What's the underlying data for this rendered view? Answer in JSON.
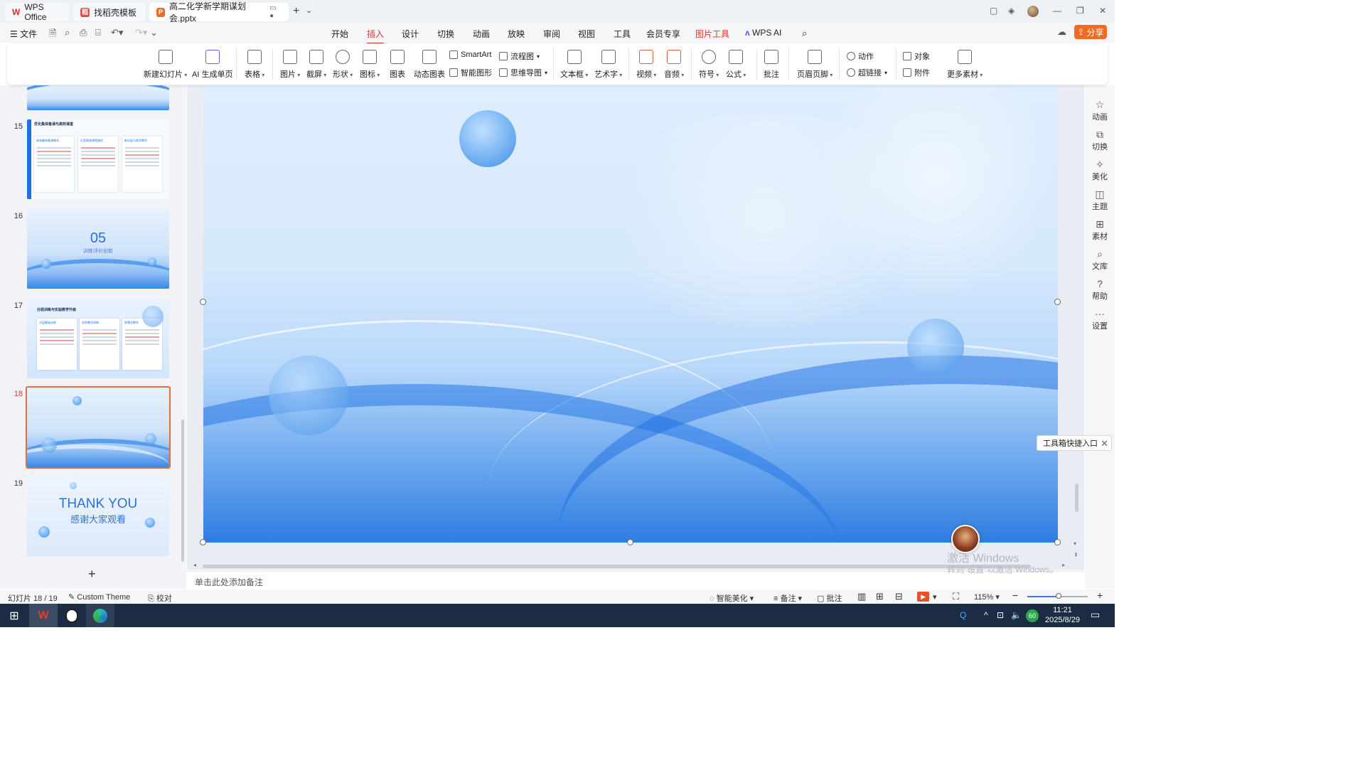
{
  "colors": {
    "accent": "#d9382b",
    "share": "#f56a1f",
    "selection_border": "#e46d3d"
  },
  "tabs": [
    {
      "label": "WPS Office",
      "icon": "wps-logo-icon"
    },
    {
      "label": "找稻壳模板",
      "icon": "docer-icon"
    },
    {
      "label": "高二化学新学期谋划会.pptx",
      "icon": "presentation-file-icon"
    }
  ],
  "menu": {
    "file": "文件",
    "ribbon_tabs": [
      "开始",
      "插入",
      "设计",
      "切换",
      "动画",
      "放映",
      "审阅",
      "视图",
      "工具",
      "会员专享",
      "图片工具",
      "WPS AI"
    ],
    "active_tab": "插入",
    "share": "分享"
  },
  "ribbon": {
    "new_slide": "新建幻灯片",
    "ai_page": "AI 生成单页",
    "table": "表格",
    "picture": "图片",
    "screenshot": "截屏",
    "shape": "形状",
    "icon": "图标",
    "chart": "图表",
    "dynamic_chart": "动态图表",
    "smartart": "SmartArt",
    "flowchart": "流程图",
    "smart_graphic": "智能图形",
    "mindmap": "思维导图",
    "textbox": "文本框",
    "wordart": "艺术字",
    "video": "视频",
    "audio": "音频",
    "symbol": "符号",
    "formula": "公式",
    "comment": "批注",
    "header_footer": "页眉页脚",
    "action": "动作",
    "hyperlink": "超链接",
    "object": "对象",
    "attachment": "附件",
    "more_material": "更多素材"
  },
  "slides": {
    "items": [
      {
        "num": "15",
        "title": "优化集体备课与高效课堂",
        "cards": [
          "高效集体备课模式",
          "打造高效课堂路径",
          "新分层与差异教学"
        ]
      },
      {
        "num": "16",
        "big": "05",
        "sub": "训练评价创新"
      },
      {
        "num": "17",
        "title": "分层训练与实验教学升级",
        "cards": [
          "分层精准训练",
          "实验教学创新",
          "智慧化教学"
        ]
      },
      {
        "num": "18"
      },
      {
        "num": "19",
        "big": "THANK YOU",
        "sub": "感谢大家观看"
      }
    ],
    "selected": "18"
  },
  "notes_placeholder": "单击此处添加备注",
  "right_bar": [
    "动画",
    "切换",
    "美化",
    "主题",
    "素材",
    "文库",
    "帮助",
    "设置"
  ],
  "tool_popup": "工具箱快捷入口",
  "watermark": {
    "line1": "激活 Windows",
    "line2": "转到\"设置\"以激活 Windows。"
  },
  "status": {
    "slide_counter": "幻灯片 18 / 19",
    "theme": "Custom Theme",
    "proofread": "校对",
    "beautify": "智能美化",
    "notes": "备注",
    "comments": "批注",
    "zoom": "115%",
    "zoom_fraction": 0.52
  },
  "taskbar": {
    "time": "11:21",
    "date": "2025/8/29",
    "battery": "60"
  }
}
